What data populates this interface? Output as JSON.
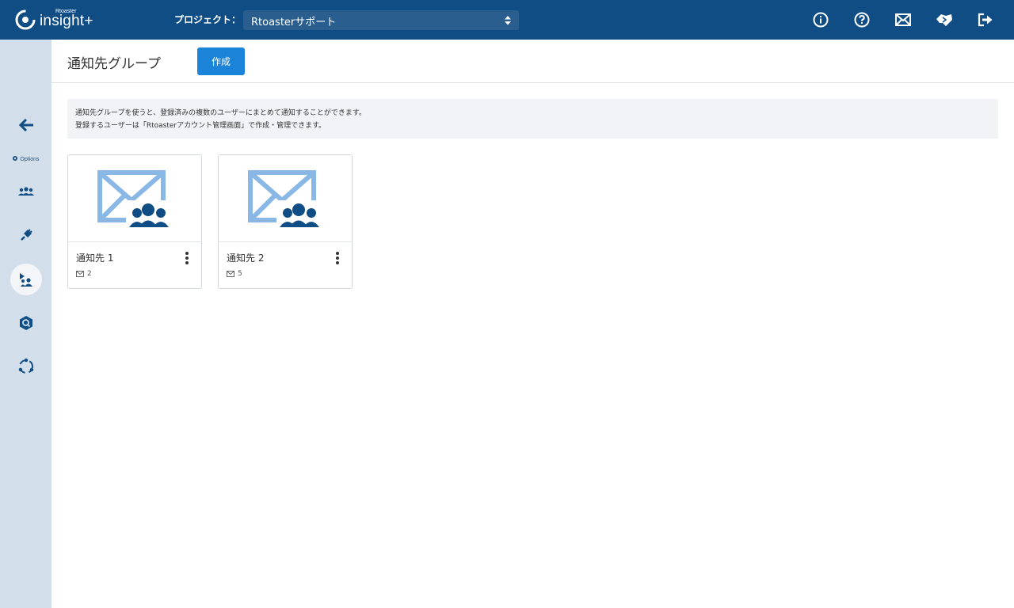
{
  "header": {
    "logo_small": "Rtoaster",
    "logo_main": "insight+",
    "project_label": "プロジェクト：",
    "project_value": "Rtoasterサポート",
    "icons": [
      "info-icon",
      "help-icon",
      "mail-icon",
      "handshake-icon",
      "logout-icon"
    ]
  },
  "sidebar": {
    "options_label": "Options",
    "items": [
      "back-arrow-icon",
      "options-gear-icon",
      "segment-users-icon",
      "plugin-icon",
      "notification-group-icon",
      "search-hexagon-icon",
      "cycle-icon"
    ]
  },
  "page": {
    "title": "通知先グループ",
    "create_label": "作成",
    "info_line1": "通知先グループを使うと、登録済みの複数のユーザーにまとめて通知することができます。",
    "info_line2": "登録するユーザーは「Rtoasterアカウント管理画面」で作成・管理できます。"
  },
  "cards": [
    {
      "name": "通知先 1",
      "count": "2"
    },
    {
      "name": "通知先 2",
      "count": "5"
    }
  ],
  "colors": {
    "topbar": "#0f4d84",
    "sidebar": "#d2dfea",
    "accent_button": "#1b84d8",
    "envelope_light": "#8ab8e6",
    "people_dark": "#0f4d84"
  }
}
